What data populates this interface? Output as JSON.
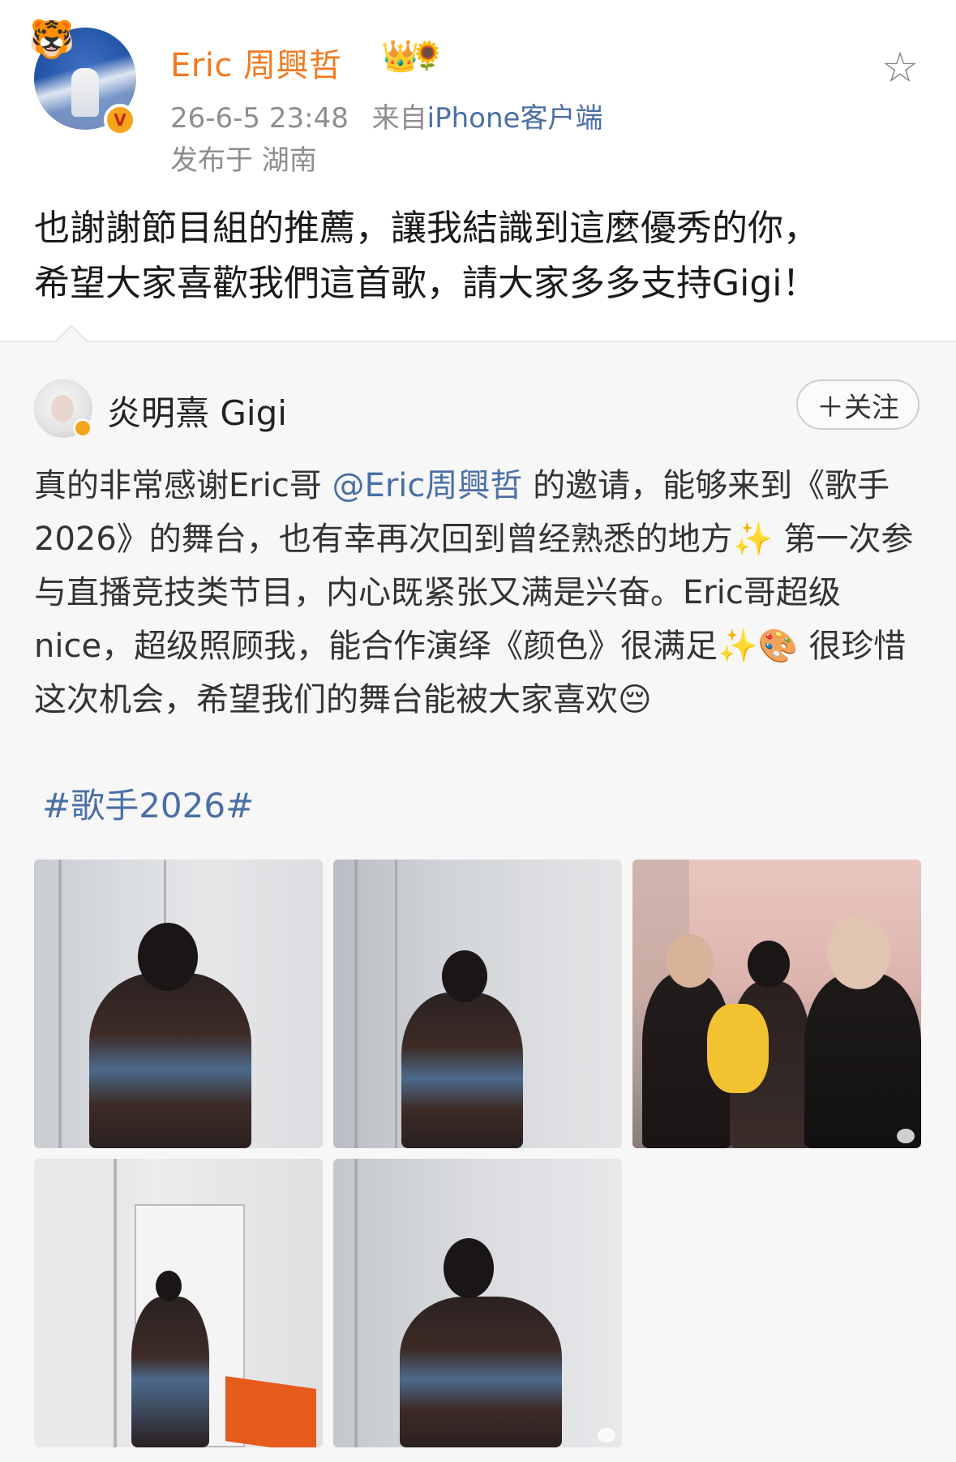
{
  "post": {
    "author": "Eric 周興哲",
    "timestamp": "26-6-5 23:48",
    "source_prefix": "来自",
    "source": "iPhone客户端",
    "location": "发布于 湖南",
    "text_line1": "也謝謝節目組的推薦，讓我結識到這麼優秀的你，",
    "text_line2": "希望大家喜歡我們這首歌，請大家多多支持Gigi！",
    "icons": {
      "badge_1": "crown-icon",
      "badge_2": "sunflower-icon",
      "favorite": "star-icon",
      "verified": "verified-badge"
    }
  },
  "repost": {
    "author": "炎明熹 Gigi",
    "follow_label": "＋关注",
    "text_part1": "真的非常感谢Eric哥 ",
    "mention": "@Eric周興哲",
    "text_part2": " 的邀请，能够来到《歌手2026》的舞台，也有幸再次回到曾经熟悉的地方",
    "sparkles_1": "✨",
    "text_part3": " 第一次参与直播竞技类节目，内心既紧张又满是兴奋。Eric哥超级 nice，超级照顾我，能合作演绎《颜色》很满足",
    "sparkles_2": "✨",
    "palette": "🎨",
    "text_part4": " 很珍惜这次机会，希望我们的舞台能被大家喜欢",
    "pensive": "😔",
    "hashtag": "#歌手2026#",
    "photos": [
      "photo-1",
      "photo-2",
      "photo-3",
      "photo-4",
      "photo-5"
    ]
  },
  "colors": {
    "username": "#f37a1f",
    "link": "#4a6fa5",
    "meta": "#8e8e8e",
    "repost_bg": "#f7f7f7"
  }
}
